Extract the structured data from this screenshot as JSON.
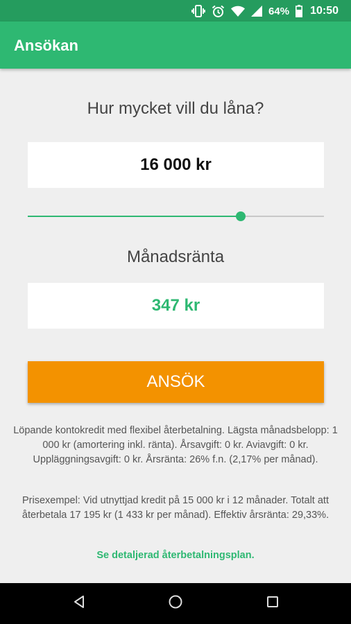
{
  "status_bar": {
    "battery_percent": "64%",
    "time": "10:50"
  },
  "app_bar": {
    "title": "Ansökan"
  },
  "loan": {
    "question": "Hur mycket vill du låna?",
    "amount": "16 000 kr",
    "slider_fraction": 0.72
  },
  "rate": {
    "label": "Månadsränta",
    "value": "347 kr"
  },
  "apply_button": {
    "label": "ANSÖK"
  },
  "info": {
    "terms": "Löpande kontokredit med flexibel återbetalning. Lägsta månadsbelopp: 1 000 kr (amortering inkl. ränta). Årsavgift: 0 kr. Aviavgift: 0 kr. Uppläggningsavgift: 0 kr. Årsränta: 26% f.n. (2,17% per månad).",
    "example": "Prisexempel: Vid utnyttjad kredit på 15 000 kr i 12 månader. Totalt att återbetala 17 195 kr (1 433 kr per månad). Effektiv årsränta: 29,33%.",
    "link": "Se detaljerad återbetalningsplan."
  },
  "colors": {
    "primary": "#2eb872",
    "status": "#259c5e",
    "accent": "#f39200",
    "background": "#efefef"
  },
  "icons": [
    "vibrate-icon",
    "alarm-icon",
    "wifi-icon",
    "signal-icon",
    "battery-icon",
    "back-icon",
    "home-icon",
    "recents-icon"
  ]
}
